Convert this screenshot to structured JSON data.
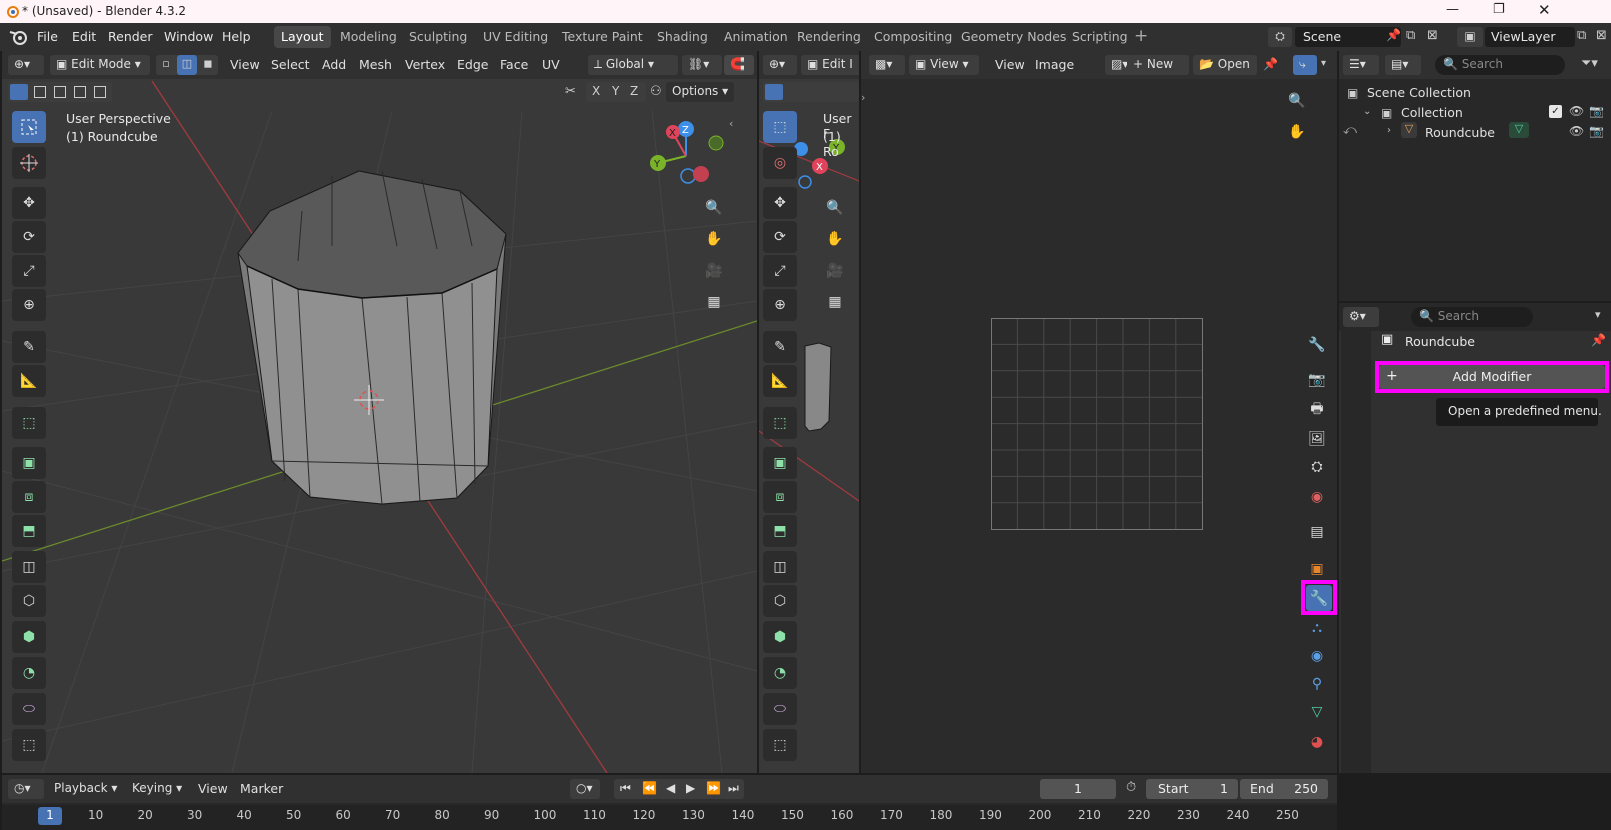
{
  "window": {
    "title": "* (Unsaved) - Blender 4.3.2"
  },
  "menu": {
    "file": "File",
    "edit": "Edit",
    "render": "Render",
    "window": "Window",
    "help": "Help"
  },
  "workspaces": [
    "Layout",
    "Modeling",
    "Sculpting",
    "UV Editing",
    "Texture Paint",
    "Shading",
    "Animation",
    "Rendering",
    "Compositing",
    "Geometry Nodes",
    "Scripting"
  ],
  "scene": {
    "name": "Scene",
    "view_layer": "ViewLayer"
  },
  "viewport": {
    "mode": "Edit Mode",
    "menus": [
      "View",
      "Select",
      "Add",
      "Mesh",
      "Vertex",
      "Edge",
      "Face",
      "UV"
    ],
    "transform_orientation": "Global",
    "axes": [
      "X",
      "Y",
      "Z"
    ],
    "options": "Options",
    "overlay_line1": "User Perspective",
    "overlay_line2": "(1) Roundcube"
  },
  "viewport2": {
    "mode": "Edit I",
    "overlay_line1": "User F",
    "overlay_line2": "(1) Ro"
  },
  "image_editor": {
    "view1": "View",
    "view2": "View",
    "image": "Image",
    "new": "New",
    "open": "Open"
  },
  "outliner": {
    "search_placeholder": "Search",
    "scene_collection": "Scene Collection",
    "collection": "Collection",
    "object": "Roundcube"
  },
  "properties": {
    "search_placeholder": "Search",
    "object_name": "Roundcube",
    "add_modifier": "Add Modifier",
    "tooltip": "Open a predefined menu."
  },
  "timeline": {
    "playback": "Playback",
    "keying": "Keying",
    "view": "View",
    "marker": "Marker",
    "current_frame": "1",
    "start_label": "Start",
    "start": "1",
    "end_label": "End",
    "end": "250",
    "ruler_current": "1",
    "ruler": [
      "10",
      "20",
      "30",
      "40",
      "50",
      "60",
      "70",
      "80",
      "90",
      "100",
      "110",
      "120",
      "130",
      "140",
      "150",
      "160",
      "170",
      "180",
      "190",
      "200",
      "210",
      "220",
      "230",
      "240",
      "250"
    ]
  },
  "colors": {
    "highlight": "#ff00ff",
    "accent": "#4772b3",
    "x_axis": "#e0445a",
    "y_axis": "#7ab32a",
    "z_axis": "#3d8fe8"
  }
}
